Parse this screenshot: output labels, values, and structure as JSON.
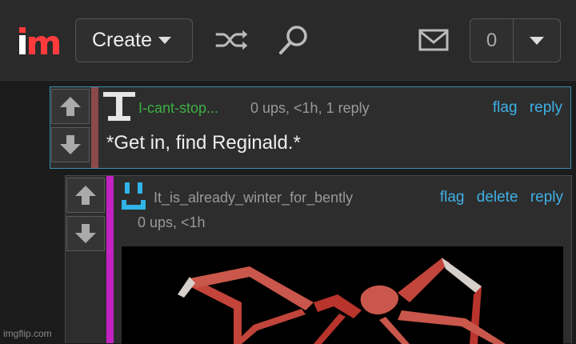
{
  "header": {
    "create_label": "Create",
    "notification_count": "0"
  },
  "comments": [
    {
      "username": "I-cant-stop...",
      "username_color": "#3cb043",
      "meta": "0 ups, <1h, 1 reply",
      "actions": [
        "flag",
        "reply"
      ],
      "text": "*Get in, find Reginald.*"
    },
    {
      "username": "It_is_already_winter_for_bently",
      "username_color": "#999999",
      "meta": "0 ups, <1h",
      "actions": [
        "flag",
        "delete",
        "reply"
      ],
      "image": "spider-crab-image"
    }
  ],
  "watermark": "imgflip.com"
}
